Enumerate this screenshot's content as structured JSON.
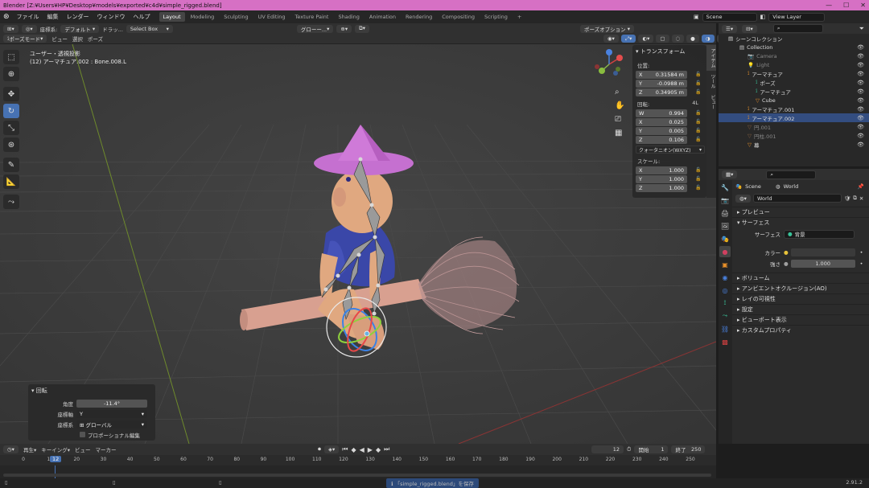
{
  "titlebar": {
    "title": "Blender [Z:¥Users¥HP¥Desktop¥models¥exported¥c4d¥simple_rigged.blend]"
  },
  "menu": [
    "ファイル",
    "編集",
    "レンダー",
    "ウィンドウ",
    "ヘルプ"
  ],
  "workspaces": [
    "Layout",
    "Modeling",
    "Sculpting",
    "UV Editing",
    "Texture Paint",
    "Shading",
    "Animation",
    "Rendering",
    "Compositing",
    "Scripting"
  ],
  "scene": {
    "name": "Scene",
    "view_layer": "View Layer"
  },
  "vp_header1": {
    "coord_label": "座標系:",
    "coord_value": "デフォルト",
    "drag_label": "ドラッ...",
    "select_box": "Select Box",
    "global": "グローー...",
    "pose_options": "ポーズオプション"
  },
  "vp_header2": {
    "mode": "ポーズモード",
    "menus": [
      "ビュー",
      "選択",
      "ポーズ"
    ]
  },
  "viewport": {
    "view_name": "ユーザー・透視投影",
    "object_info": "(12) アーマチュア.002 : Bone.008.L"
  },
  "npanel": {
    "title": "トランスフォーム",
    "location_label": "位置:",
    "location": [
      {
        "axis": "X",
        "value": "0.31584 m"
      },
      {
        "axis": "Y",
        "value": "-0.0988 m"
      },
      {
        "axis": "Z",
        "value": "0.34905 m"
      }
    ],
    "rotation_label": "回転:",
    "rotation_mode_tag": "4L",
    "rotation": [
      {
        "axis": "W",
        "value": "0.994"
      },
      {
        "axis": "X",
        "value": "0.025"
      },
      {
        "axis": "Y",
        "value": "0.005"
      },
      {
        "axis": "Z",
        "value": "0.106"
      }
    ],
    "rotation_mode": "クォータニオン(WXYZ)",
    "scale_label": "スケール:",
    "scale": [
      {
        "axis": "X",
        "value": "1.000"
      },
      {
        "axis": "Y",
        "value": "1.000"
      },
      {
        "axis": "Z",
        "value": "1.000"
      }
    ],
    "side_tabs": [
      "アイテム",
      "ツール",
      "ビュー"
    ]
  },
  "operator": {
    "title": "回転",
    "angle_label": "角度",
    "angle_value": "-11.4°",
    "axis_label": "座標軸",
    "axis_value": "Y",
    "orient_label": "座標系",
    "orient_value": "グローバル",
    "proportional": "プロポーショナル編集"
  },
  "outliner": {
    "header": "シーンコレクション",
    "rows": [
      {
        "label": "Collection",
        "indent": 10,
        "dim": false,
        "sel": false
      },
      {
        "label": "Camera",
        "indent": 20,
        "dim": true,
        "sel": false
      },
      {
        "label": "Light",
        "indent": 20,
        "dim": true,
        "sel": false
      },
      {
        "label": "アーマチュア",
        "indent": 20,
        "dim": false,
        "sel": false
      },
      {
        "label": "ポーズ",
        "indent": 30,
        "dim": false,
        "sel": false
      },
      {
        "label": "アーマチュア",
        "indent": 30,
        "dim": false,
        "sel": false
      },
      {
        "label": "Cube",
        "indent": 30,
        "dim": false,
        "sel": false
      },
      {
        "label": "アーマチュア.001",
        "indent": 20,
        "dim": false,
        "sel": false
      },
      {
        "label": "アーマチュア.002",
        "indent": 20,
        "dim": false,
        "sel": true
      },
      {
        "label": "円.001",
        "indent": 20,
        "dim": true,
        "sel": false
      },
      {
        "label": "円柱.001",
        "indent": 20,
        "dim": true,
        "sel": false
      },
      {
        "label": "幕",
        "indent": 20,
        "dim": false,
        "sel": false
      }
    ]
  },
  "properties": {
    "breadcrumb_scene": "Scene",
    "breadcrumb_world": "World",
    "world_name": "World",
    "sections": [
      "プレビュー",
      "サーフェス"
    ],
    "surface_label": "サーフェス",
    "surface_value": "背景",
    "color_label": "カラー",
    "strength_label": "強さ",
    "strength_value": "1.000",
    "more_sections": [
      "ボリューム",
      "アンビエントオクルージョン(AO)",
      "レイの可視性",
      "設定",
      "ビューポート表示",
      "カスタムプロパティ"
    ]
  },
  "timeline": {
    "menus": [
      "再生",
      "キーイング",
      "ビュー",
      "マーカー"
    ],
    "current_frame": "12",
    "start_label": "開始",
    "start": "1",
    "end_label": "終了",
    "end": "250",
    "ticks": [
      "0",
      "10",
      "20",
      "30",
      "40",
      "50",
      "60",
      "70",
      "80",
      "90",
      "100",
      "110",
      "120",
      "130",
      "140",
      "150",
      "160",
      "170",
      "180",
      "190",
      "200",
      "210",
      "220",
      "230",
      "240",
      "250"
    ]
  },
  "status": {
    "message": "「simple_rigged.blend」を保存",
    "version": "2.91.2"
  }
}
